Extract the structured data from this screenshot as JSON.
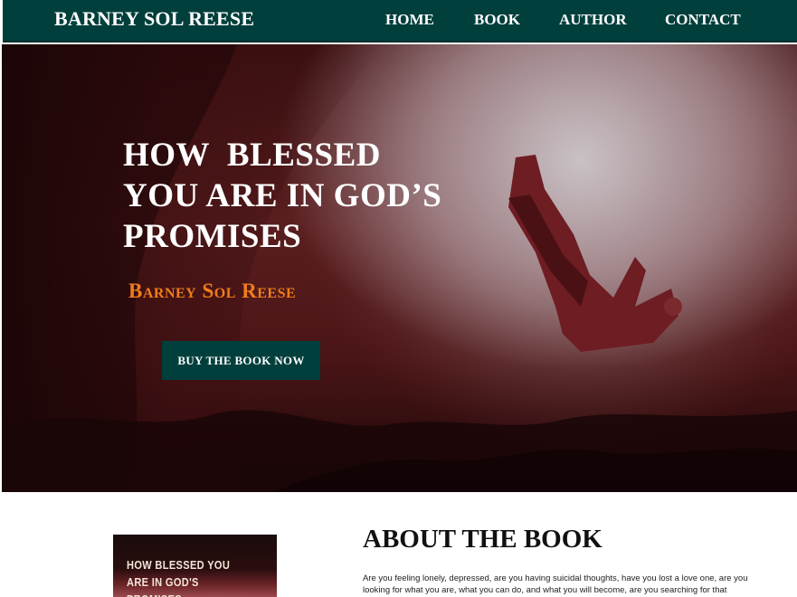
{
  "header": {
    "brand": "BARNEY SOL REESE",
    "nav": [
      {
        "label": "HOME"
      },
      {
        "label": "BOOK"
      },
      {
        "label": "AUTHOR"
      },
      {
        "label": "CONTACT"
      }
    ]
  },
  "hero": {
    "title": "HOW  BLESSED\nYOU ARE IN GOD’S\nPROMISES",
    "author": "Barney Sol Reese",
    "button_label": "BUY THE BOOK NOW"
  },
  "about": {
    "cover_title": "HOW BLESSED YOU\nARE IN GOD'S\nPROMISES",
    "title": "ABOUT THE BOOK",
    "text": "Are you feeling lonely, depressed, are you having suicidal thoughts, have you lost a love one, are you looking for what you are, what you can do, and what you will become, are you searching for that"
  },
  "colors": {
    "header_bg": "#003f3c",
    "author_accent": "#f07c1b",
    "button_bg": "#003f3c"
  }
}
